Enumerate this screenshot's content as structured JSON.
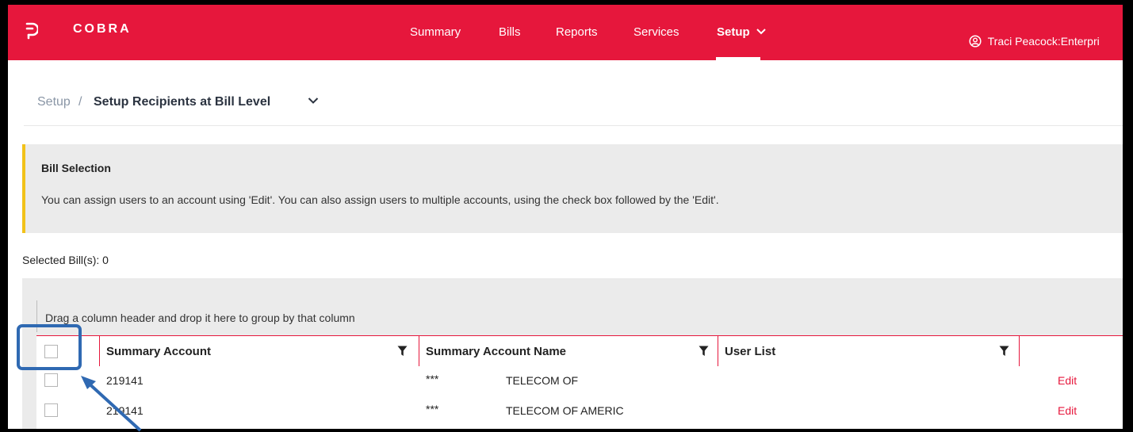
{
  "app": {
    "brand": "COBRA",
    "nav": [
      {
        "label": "Summary"
      },
      {
        "label": "Bills"
      },
      {
        "label": "Reports"
      },
      {
        "label": "Services"
      },
      {
        "label": "Setup",
        "active": true
      }
    ],
    "user_label": "Traci Peacock:Enterpri",
    "accent_color": "#e6173c",
    "info_accent_color": "#f2c21a",
    "annotation_color": "#2f69b2"
  },
  "breadcrumb": {
    "root": "Setup",
    "separator": "/",
    "current": "Setup Recipients at Bill Level"
  },
  "info": {
    "title": "Bill Selection",
    "text": "You can assign users to an account using 'Edit'. You can also assign users to multiple accounts, using the check box followed by the 'Edit'."
  },
  "selected": {
    "label": "Selected Bill(s): 0"
  },
  "grid": {
    "group_hint": "Drag a column header and drop it here to group by that column",
    "columns": [
      {
        "label": "Summary Account"
      },
      {
        "label": "Summary Account Name"
      },
      {
        "label": "User List"
      }
    ],
    "rows": [
      {
        "account": "219141",
        "mask": "***",
        "name": "TELECOM OF",
        "action": "Edit"
      },
      {
        "account": "219141",
        "mask": "***",
        "name": "TELECOM OF AMERIC",
        "action": "Edit"
      }
    ]
  },
  "icons": {
    "logo": "cobra-logo-icon",
    "user": "user-circle-icon",
    "chevron": "chevron-down-icon",
    "filter": "filter-icon",
    "arrow": "annotation-arrow"
  }
}
